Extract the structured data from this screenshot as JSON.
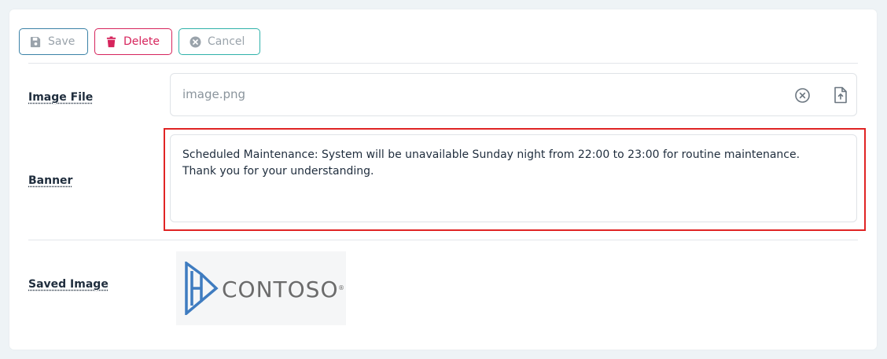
{
  "toolbar": {
    "save_label": "Save",
    "delete_label": "Delete",
    "cancel_label": "Cancel"
  },
  "form": {
    "image_file_label": "Image File",
    "image_file_value": "image.png",
    "banner_label": "Banner",
    "banner_value": "Scheduled Maintenance: System will be unavailable Sunday night from 22:00 to 23:00 for routine maintenance. Thank you for your understanding.",
    "saved_image_label": "Saved Image"
  },
  "logo": {
    "text": "CONTOSO",
    "registered": "®"
  },
  "icons": {
    "save": "save-icon",
    "delete": "trash-icon",
    "cancel": "cancel-circle-icon",
    "clear": "clear-circle-icon",
    "upload": "file-upload-icon"
  },
  "colors": {
    "primary": "#3b82a7",
    "danger": "#d6245c",
    "teal": "#2fb2aa",
    "highlight": "#e02424"
  }
}
